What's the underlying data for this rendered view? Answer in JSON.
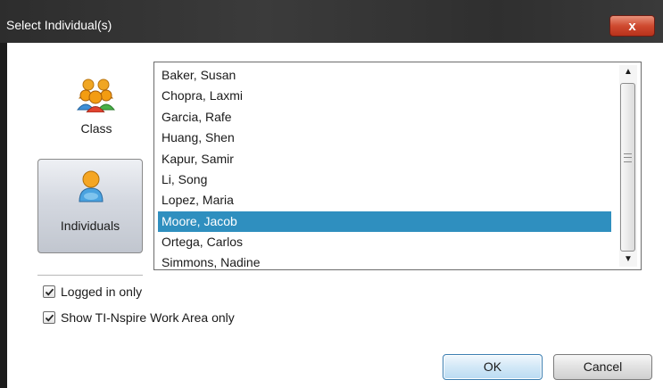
{
  "window": {
    "title": "Select Individual(s)",
    "close_label": "x"
  },
  "sidebar": {
    "class_label": "Class",
    "individuals_label": "Individuals",
    "selected": "Individuals"
  },
  "list": {
    "items": [
      "Baker, Susan",
      "Chopra, Laxmi",
      "Garcia, Rafe",
      "Huang, Shen",
      "Kapur, Samir",
      "Li, Song",
      "Lopez, Maria",
      "Moore, Jacob",
      "Ortega, Carlos",
      "Simmons, Nadine"
    ],
    "selected_item": "Moore, Jacob",
    "selection_color": "#2f8fbf"
  },
  "options": {
    "logged_in_only": {
      "label": "Logged in only",
      "checked": true
    },
    "work_area_only": {
      "label": "Show TI-Nspire Work Area only",
      "checked": true
    }
  },
  "buttons": {
    "ok_label": "OK",
    "cancel_label": "Cancel"
  },
  "icons": {
    "class": "group-people-icon",
    "individuals": "single-person-icon",
    "close": "close-icon"
  }
}
